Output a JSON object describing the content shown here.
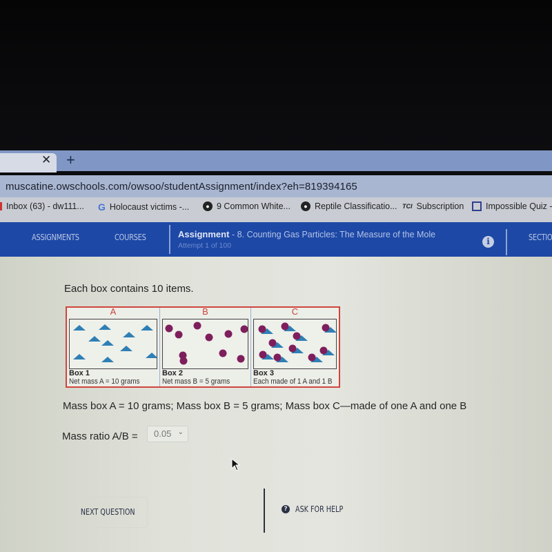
{
  "browser": {
    "url": "muscatine.owschools.com/owsoo/studentAssignment/index?eh=819394165",
    "bookmarks": [
      {
        "label": "Inbox (63) - dw111...",
        "icon": "gmail-icon"
      },
      {
        "label": "Holocaust victims -...",
        "icon": "google-icon"
      },
      {
        "label": "9 Common White...",
        "icon": "globe-icon"
      },
      {
        "label": "Reptile Classificatio...",
        "icon": "globe-icon"
      },
      {
        "label": "Subscription",
        "icon": "tcr-icon",
        "icon_text": "TCI"
      },
      {
        "label": "Impossible Quiz - U",
        "icon": "window-icon"
      }
    ]
  },
  "nav": {
    "assignments": "ASSIGNMENTS",
    "courses": "COURSES",
    "assignment_label": "Assignment",
    "assignment_title": "- 8. Counting Gas Particles: The Measure of the Mole",
    "attempt": "Attempt 1 of 100",
    "sections": "SECTION"
  },
  "question": {
    "heading": "Each box contains 10 items.",
    "boxes": [
      {
        "letter": "A",
        "label": "Box 1",
        "caption": "Net mass A = 10 grams",
        "contents": "triangles",
        "count": 10
      },
      {
        "letter": "B",
        "label": "Box 2",
        "caption": "Net mass B = 5 grams",
        "contents": "circles",
        "count": 10
      },
      {
        "letter": "C",
        "label": "Box 3",
        "caption": "Each made of 1 A and 1 B",
        "contents": "triangle+circle pairs",
        "count": 10
      }
    ],
    "statement": "Mass box A = 10 grams; Mass box B = 5 grams; Mass box C—made of one A and one B",
    "ratio_label": "Mass ratio A/B =",
    "ratio_value": "0.05"
  },
  "footer": {
    "next": "NEXT QUESTION",
    "help": "ASK FOR HELP"
  },
  "colors": {
    "nav_blue": "#1d48a6",
    "triangle": "#2f7fb5",
    "circle": "#7e1f5c",
    "figure_border": "#d0443c"
  }
}
